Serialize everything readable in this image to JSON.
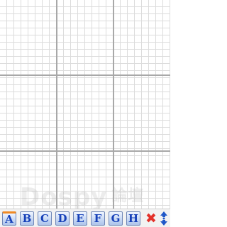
{
  "canvas": {
    "grid_color": "#dcdcdc",
    "major_line_color": "#a8a8a8",
    "background": "#ffffff"
  },
  "watermark": {
    "latin": "Dospy",
    "cjk": "論壇"
  },
  "toolbar": {
    "letters": [
      {
        "label": "A",
        "active": true
      },
      {
        "label": "B",
        "active": false
      },
      {
        "label": "C",
        "active": false
      },
      {
        "label": "D",
        "active": false
      },
      {
        "label": "E",
        "active": false
      },
      {
        "label": "F",
        "active": false
      },
      {
        "label": "G",
        "active": false
      },
      {
        "label": "H",
        "active": false
      }
    ],
    "close_icon": "close-x-icon",
    "close_color": "#e3312a",
    "scroll_icon": "up-down-arrows-icon",
    "scroll_color": "#1f57c8",
    "button_text_color": "#1640b8",
    "active_indicator_color": "#f08a24"
  }
}
